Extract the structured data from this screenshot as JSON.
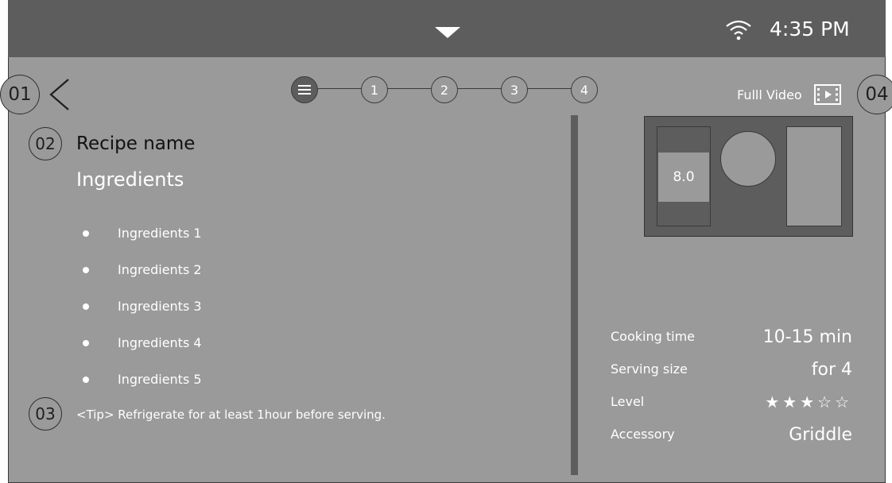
{
  "status_bar": {
    "time": "4:35 PM",
    "wifi_icon": "wifi-icon",
    "pulldown_icon": "chevron-down-icon"
  },
  "annotations": [
    "01",
    "02",
    "03",
    "04"
  ],
  "navigation": {
    "back_icon": "back-chevron-icon"
  },
  "stepper": {
    "list_icon": "list-icon",
    "steps": [
      "1",
      "2",
      "3",
      "4"
    ]
  },
  "video": {
    "label": "Fulll Video",
    "icon": "film-play-icon"
  },
  "recipe": {
    "name": "Recipe name",
    "ingredients_title": "Ingredients",
    "ingredients": [
      "Ingredients 1",
      "Ingredients 2",
      "Ingredients 3",
      "Ingredients 4",
      "Ingredients 5"
    ],
    "tip": "<Tip> Refrigerate for at least 1hour before serving."
  },
  "cooktop": {
    "left_zone_value": "8.0"
  },
  "info": {
    "cooking_time_label": "Cooking time",
    "cooking_time_value": "10-15 min",
    "serving_size_label": "Serving size",
    "serving_size_value": "for 4",
    "level_label": "Level",
    "level_rating": 3,
    "level_max": 5,
    "level_stars": "★★★☆☆",
    "accessory_label": "Accessory",
    "accessory_value": "Griddle"
  },
  "colors": {
    "background": "#9a9a9b",
    "top_bar": "#5d5d5e",
    "accent_dark": "#5d5d5e",
    "text": "#ffffff"
  }
}
